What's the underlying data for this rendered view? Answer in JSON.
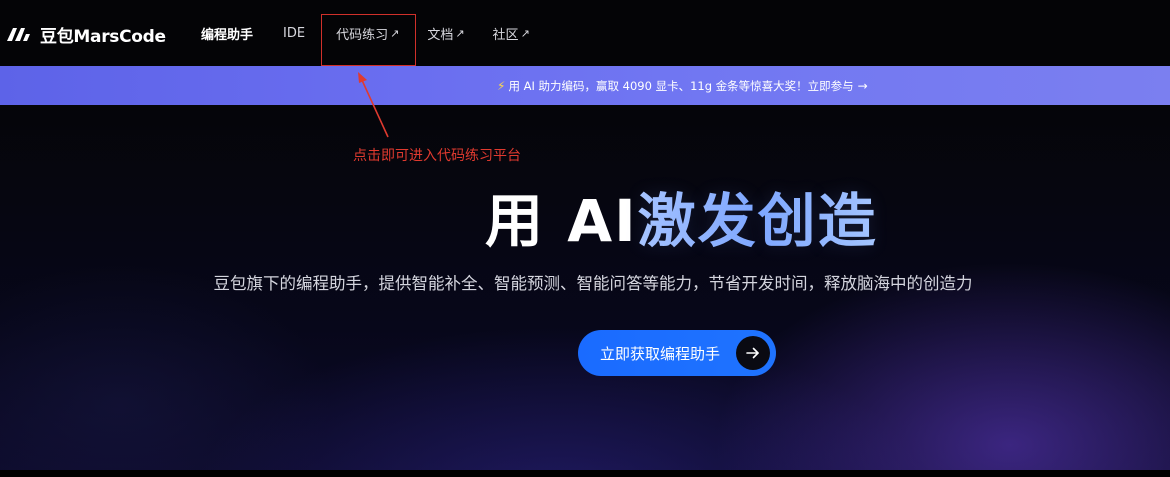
{
  "navbar": {
    "logo_text": "豆包MarsCode",
    "items": [
      {
        "label": "编程助手",
        "external": false,
        "active": true
      },
      {
        "label": "IDE",
        "external": false,
        "active": false
      },
      {
        "label": "代码练习",
        "external": true,
        "active": false
      },
      {
        "label": "文档",
        "external": true,
        "active": false
      },
      {
        "label": "社区",
        "external": true,
        "active": false
      }
    ],
    "external_arrow": "↗"
  },
  "banner": {
    "text": "用 AI 助力编码，赢取 4090 显卡、11g 金条等惊喜大奖！立即参与",
    "bolt": "⚡",
    "arrow": "→"
  },
  "annotation": {
    "text": "点击即可进入代码练习平台",
    "color": "#e03a2f"
  },
  "hero": {
    "headline_plain": "用 AI ",
    "headline_highlight": "激发创造",
    "subtitle": "豆包旗下的编程助手，提供智能补全、智能预测、智能问答等能力，节省开发时间，释放脑海中的创造力",
    "cta_label": "立即获取编程助手",
    "cta_icon": "arrow-right-icon"
  },
  "colors": {
    "banner_start": "#5d63e8",
    "banner_end": "#7b7ff0",
    "cta": "#1a6bff",
    "headline_gradient": "#7fa8ff",
    "highlight_box": "#d0302a"
  }
}
